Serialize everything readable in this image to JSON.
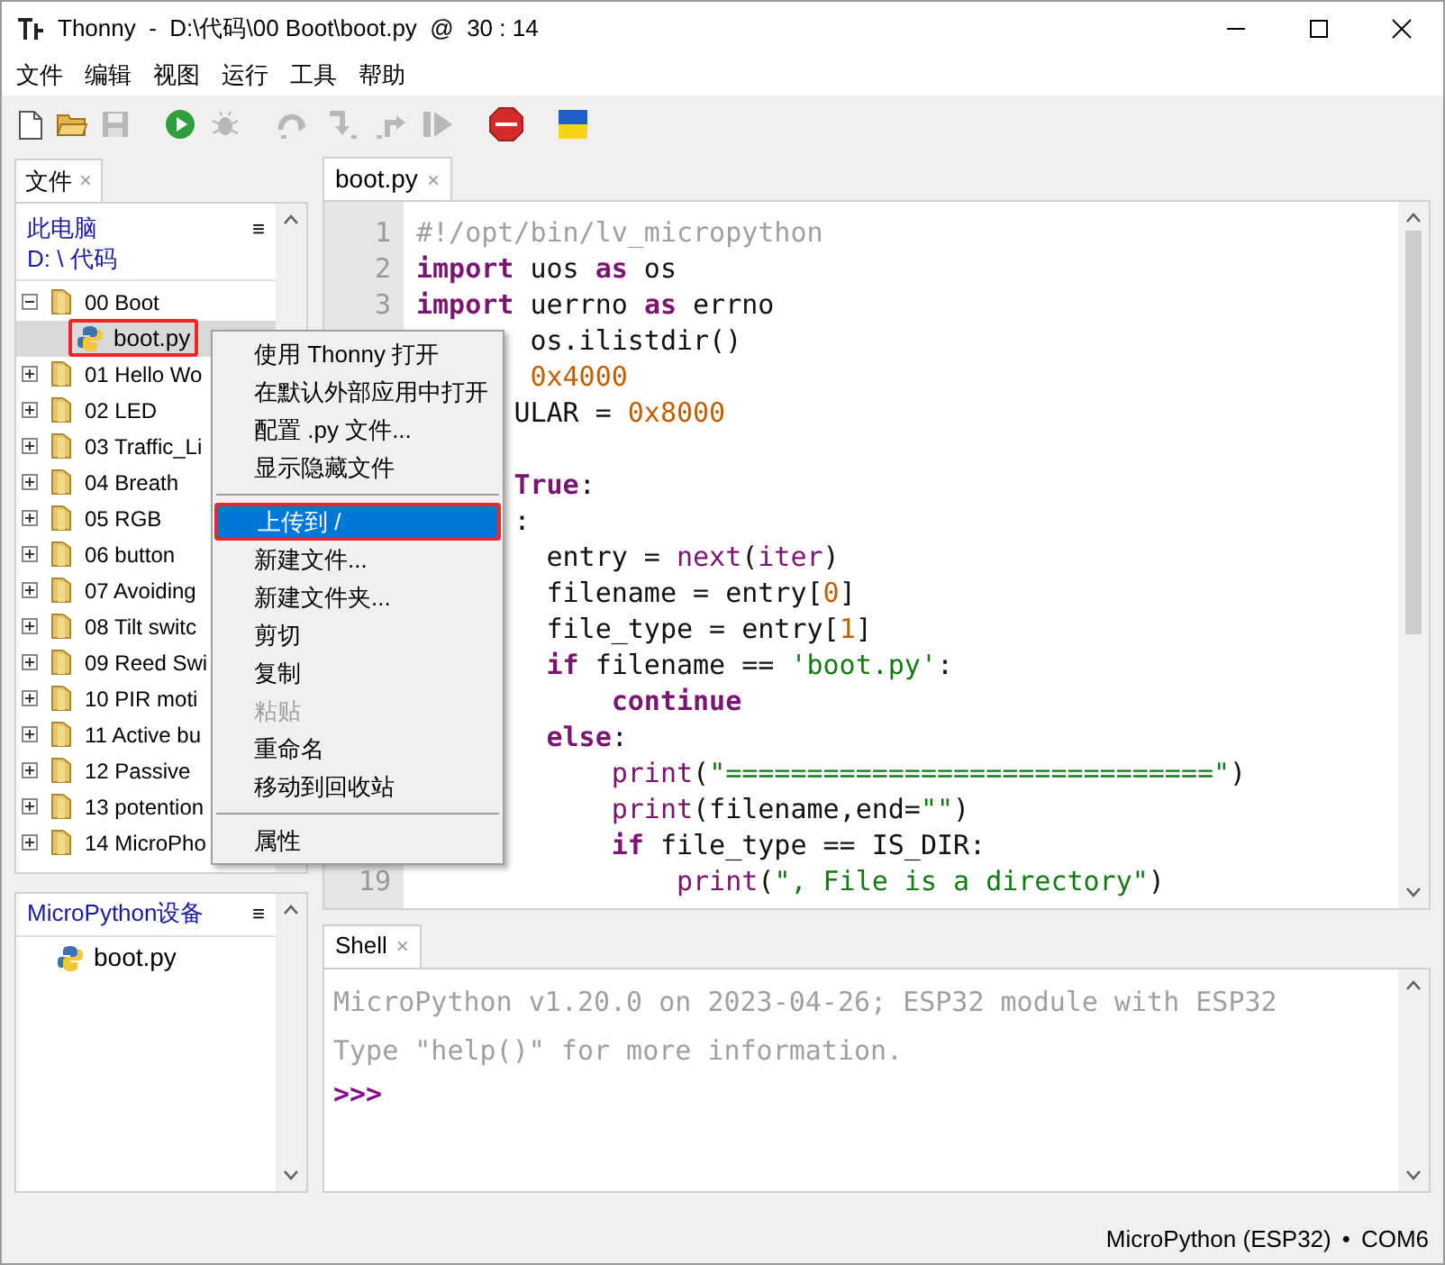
{
  "window": {
    "title": "Thonny  -  D:\\代码\\00 Boot\\boot.py  @  30 : 14"
  },
  "menu_bar": [
    "文件",
    "编辑",
    "视图",
    "运行",
    "工具",
    "帮助"
  ],
  "toolbar": [
    {
      "kind": "new",
      "disabled": false
    },
    {
      "kind": "open",
      "disabled": false
    },
    {
      "kind": "save",
      "disabled": true
    },
    {
      "kind": "run",
      "disabled": false
    },
    {
      "kind": "debug",
      "disabled": true
    },
    {
      "kind": "step_over",
      "disabled": true
    },
    {
      "kind": "step_into",
      "disabled": true
    },
    {
      "kind": "step_out",
      "disabled": true
    },
    {
      "kind": "resume",
      "disabled": true
    },
    {
      "kind": "stop",
      "disabled": false
    },
    {
      "kind": "flag",
      "disabled": false
    }
  ],
  "files_panel": {
    "tab": "文件",
    "close_glyph": "×",
    "location": "此电脑",
    "path": "D: \\ 代码",
    "menu_glyph": "≡",
    "tree": [
      {
        "name": "00 Boot",
        "kind": "folder",
        "expanded": true,
        "children": [
          {
            "name": "boot.py",
            "kind": "python",
            "selected": true,
            "highlighted": true
          }
        ]
      },
      {
        "name": "01 Hello Wo",
        "kind": "folder",
        "expanded": false
      },
      {
        "name": "02 LED",
        "kind": "folder",
        "expanded": false
      },
      {
        "name": "03 Traffic_Li",
        "kind": "folder",
        "expanded": false
      },
      {
        "name": "04 Breath",
        "kind": "folder",
        "expanded": false
      },
      {
        "name": "05 RGB",
        "kind": "folder",
        "expanded": false
      },
      {
        "name": "06 button",
        "kind": "folder",
        "expanded": false
      },
      {
        "name": "07 Avoiding",
        "kind": "folder",
        "expanded": false
      },
      {
        "name": "08 Tilt switc",
        "kind": "folder",
        "expanded": false
      },
      {
        "name": "09 Reed Swi",
        "kind": "folder",
        "expanded": false
      },
      {
        "name": "10 PIR moti",
        "kind": "folder",
        "expanded": false
      },
      {
        "name": "11 Active bu",
        "kind": "folder",
        "expanded": false
      },
      {
        "name": "12 Passive",
        "kind": "folder",
        "expanded": false
      },
      {
        "name": "13 potention",
        "kind": "folder",
        "expanded": false
      },
      {
        "name": "14 MicroPho",
        "kind": "folder",
        "expanded": false
      }
    ]
  },
  "device_panel": {
    "title": "MicroPython设备",
    "menu_glyph": "≡",
    "files": [
      {
        "name": "boot.py",
        "kind": "python"
      }
    ]
  },
  "editor": {
    "tab": "boot.py",
    "close_glyph": "×",
    "lines": [
      {
        "num": "1",
        "tokens": [
          {
            "kind": "comment",
            "text": "#!/opt/bin/lv_micropython"
          }
        ]
      },
      {
        "num": "2",
        "tokens": [
          {
            "kind": "kw",
            "text": "import"
          },
          {
            "kind": "plain",
            "text": " uos "
          },
          {
            "kind": "kw",
            "text": "as"
          },
          {
            "kind": "plain",
            "text": " os"
          }
        ]
      },
      {
        "num": "3",
        "tokens": [
          {
            "kind": "kw",
            "text": "import"
          },
          {
            "kind": "plain",
            "text": " uerrno "
          },
          {
            "kind": "kw",
            "text": "as"
          },
          {
            "kind": "plain",
            "text": " errno"
          }
        ]
      },
      {
        "tokens": [
          {
            "kind": "plain",
            "text": "       os.ilistdir()"
          }
        ]
      },
      {
        "tokens": [
          {
            "kind": "num",
            "text": "       0x4000"
          }
        ]
      },
      {
        "tokens": [
          {
            "kind": "plain",
            "text": "      ULAR = "
          },
          {
            "kind": "num",
            "text": "0x8000"
          }
        ]
      },
      {
        "kind": "blank"
      },
      {
        "tokens": [
          {
            "kind": "kw",
            "text": "      True"
          },
          {
            "kind": "plain",
            "text": ":"
          }
        ]
      },
      {
        "tokens": [
          {
            "kind": "plain",
            "text": "      :"
          }
        ]
      },
      {
        "tokens": [
          {
            "kind": "plain",
            "text": "        entry = "
          },
          {
            "kind": "builtin",
            "text": "next"
          },
          {
            "kind": "plain",
            "text": "("
          },
          {
            "kind": "builtin",
            "text": "iter"
          },
          {
            "kind": "plain",
            "text": ")"
          }
        ]
      },
      {
        "tokens": [
          {
            "kind": "plain",
            "text": "        filename = entry["
          },
          {
            "kind": "num",
            "text": "0"
          },
          {
            "kind": "plain",
            "text": "]"
          }
        ]
      },
      {
        "tokens": [
          {
            "kind": "plain",
            "text": "        file_type = entry["
          },
          {
            "kind": "num",
            "text": "1"
          },
          {
            "kind": "plain",
            "text": "]"
          }
        ]
      },
      {
        "tokens": [
          {
            "kind": "kw",
            "text": "        if"
          },
          {
            "kind": "plain",
            "text": " filename == "
          },
          {
            "kind": "str",
            "text": "'boot.py'"
          },
          {
            "kind": "plain",
            "text": ":"
          }
        ]
      },
      {
        "tokens": [
          {
            "kind": "kw",
            "text": "            continue"
          }
        ]
      },
      {
        "tokens": [
          {
            "kind": "kw",
            "text": "        else"
          },
          {
            "kind": "plain",
            "text": ":"
          }
        ]
      },
      {
        "tokens": [
          {
            "kind": "builtin",
            "text": "            print"
          },
          {
            "kind": "plain",
            "text": "("
          },
          {
            "kind": "str",
            "text": "\"==============================\""
          },
          {
            "kind": "plain",
            "text": ")"
          }
        ]
      },
      {
        "tokens": [
          {
            "kind": "builtin",
            "text": "            print"
          },
          {
            "kind": "plain",
            "text": "(filename,end="
          },
          {
            "kind": "str",
            "text": "\"\""
          },
          {
            "kind": "plain",
            "text": ")"
          }
        ]
      },
      {
        "tokens": [
          {
            "kind": "kw",
            "text": "            if"
          },
          {
            "kind": "plain",
            "text": " file_type == IS_DIR:"
          }
        ]
      },
      {
        "num": "19",
        "tokens": [
          {
            "kind": "builtin",
            "text": "                print"
          },
          {
            "kind": "plain",
            "text": "("
          },
          {
            "kind": "str",
            "text": "\", File is a directory\""
          },
          {
            "kind": "plain",
            "text": ")"
          }
        ]
      }
    ]
  },
  "context_menu": [
    {
      "kind": "item",
      "text": "使用 Thonny 打开",
      "disabled": false,
      "selected": false
    },
    {
      "kind": "item",
      "text": "在默认外部应用中打开",
      "disabled": false,
      "selected": false
    },
    {
      "kind": "item",
      "text": "配置 .py 文件...",
      "disabled": false,
      "selected": false
    },
    {
      "kind": "item",
      "text": "显示隐藏文件",
      "disabled": false,
      "selected": false
    },
    {
      "kind": "separator"
    },
    {
      "kind": "item",
      "text": "上传到 /",
      "disabled": false,
      "selected": true,
      "highlighted": true
    },
    {
      "kind": "item",
      "text": "新建文件...",
      "disabled": false,
      "selected": false
    },
    {
      "kind": "item",
      "text": "新建文件夹...",
      "disabled": false,
      "selected": false
    },
    {
      "kind": "item",
      "text": "剪切",
      "disabled": false,
      "selected": false
    },
    {
      "kind": "item",
      "text": "复制",
      "disabled": false,
      "selected": false
    },
    {
      "kind": "item",
      "text": "粘贴",
      "disabled": true,
      "selected": false
    },
    {
      "kind": "item",
      "text": "重命名",
      "disabled": false,
      "selected": false
    },
    {
      "kind": "item",
      "text": "移动到回收站",
      "disabled": false,
      "selected": false
    },
    {
      "kind": "separator"
    },
    {
      "kind": "item",
      "text": "属性",
      "disabled": false,
      "selected": false
    }
  ],
  "shell": {
    "tab": "Shell",
    "close_glyph": "×",
    "lines": [
      {
        "kind": "output",
        "text": "MicroPython v1.20.0 on 2023-04-26; ESP32 module with ESP32"
      },
      {
        "kind": "output",
        "text": "Type \"help()\" for more information."
      },
      {
        "kind": "prompt",
        "text": ">>>"
      }
    ]
  },
  "status_bar": {
    "interpreter": "MicroPython (ESP32)",
    "separator": "•",
    "port": "COM6"
  }
}
